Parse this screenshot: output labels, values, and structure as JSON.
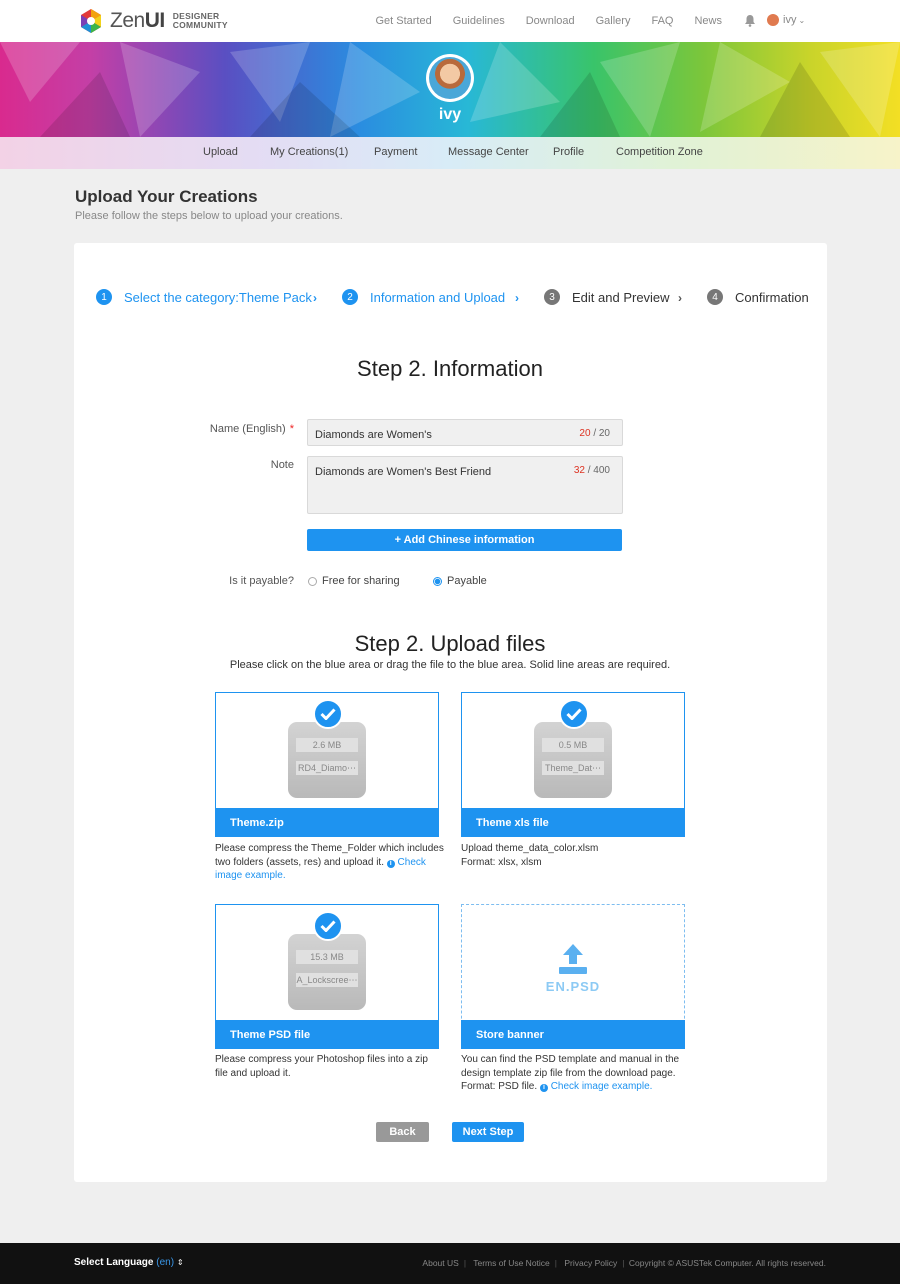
{
  "logo": {
    "name_a": "Zen",
    "name_b": "UI",
    "sub_a": "DESIGNER",
    "sub_b": "COMMUNITY"
  },
  "topnav": {
    "items": [
      "Get Started",
      "Guidelines",
      "Download",
      "Gallery",
      "FAQ",
      "News"
    ],
    "user": "ivy"
  },
  "profile": {
    "name": "ivy"
  },
  "subnav": {
    "items": [
      "Upload",
      "My Creations(1)",
      "Payment",
      "Message Center",
      "Profile",
      "Competition Zone"
    ]
  },
  "page": {
    "title": "Upload Your Creations",
    "subtitle": "Please follow the steps below to upload your creations."
  },
  "steps": [
    {
      "num": "1",
      "label": "Select the category:Theme Pack",
      "state": "active"
    },
    {
      "num": "2",
      "label": "Information and Upload",
      "state": "active"
    },
    {
      "num": "3",
      "label": "Edit and Preview",
      "state": "inactive"
    },
    {
      "num": "4",
      "label": "Confirmation",
      "state": "inactive"
    }
  ],
  "info": {
    "heading": "Step 2. Information",
    "name_label": "Name (English)",
    "name_required": "*",
    "name_value": "Diamonds are Women's",
    "name_count": "20",
    "name_max": "/ 20",
    "note_label": "Note",
    "note_value": "Diamonds are Women's Best Friend",
    "note_count": "32",
    "note_max": "/ 400",
    "add_chinese": "+ Add Chinese information",
    "payable_label": "Is it payable?",
    "option_free": "Free for sharing",
    "option_payable": "Payable",
    "selected": "Payable"
  },
  "upload": {
    "heading": "Step 2. Upload files",
    "hint": "Please click on the blue area or drag the file to the blue area. Solid line areas are required.",
    "boxes": [
      {
        "title": "Theme.zip",
        "size": "2.6 MB",
        "file": "RD4_Diamo⋯",
        "desc_a": "Please compress the Theme_Folder which includes two folders (assets, res) and upload it.",
        "link": "Check image example."
      },
      {
        "title": "Theme xls file",
        "size": "0.5 MB",
        "file": "Theme_Dat⋯",
        "desc_a": "Upload theme_data_color.xlsm",
        "desc_b": "Format: xlsx, xlsm"
      },
      {
        "title": "Theme PSD file",
        "size": "15.3 MB",
        "file": "A_Lockscree⋯",
        "desc_a": "Please compress your Photoshop files into a zip file and upload it."
      },
      {
        "title": "Store banner",
        "placeholder": "EN.PSD",
        "desc_a": "You can find the PSD template and manual in the design template zip file from the download page.",
        "desc_b": "Format: PSD file.",
        "link": "Check image example."
      }
    ]
  },
  "actions": {
    "back": "Back",
    "next": "Next Step"
  },
  "footer": {
    "lang_label": "Select Language",
    "lang_code": "(en)",
    "links": [
      "About US",
      "Terms of Use Notice",
      "Privacy Policy",
      "Copyright © ASUSTek Computer. All rights reserved."
    ]
  },
  "colors": {
    "accent": "#1e93f0",
    "footer": "#111111",
    "page_bg": "#efefef",
    "required": "#e22222"
  }
}
